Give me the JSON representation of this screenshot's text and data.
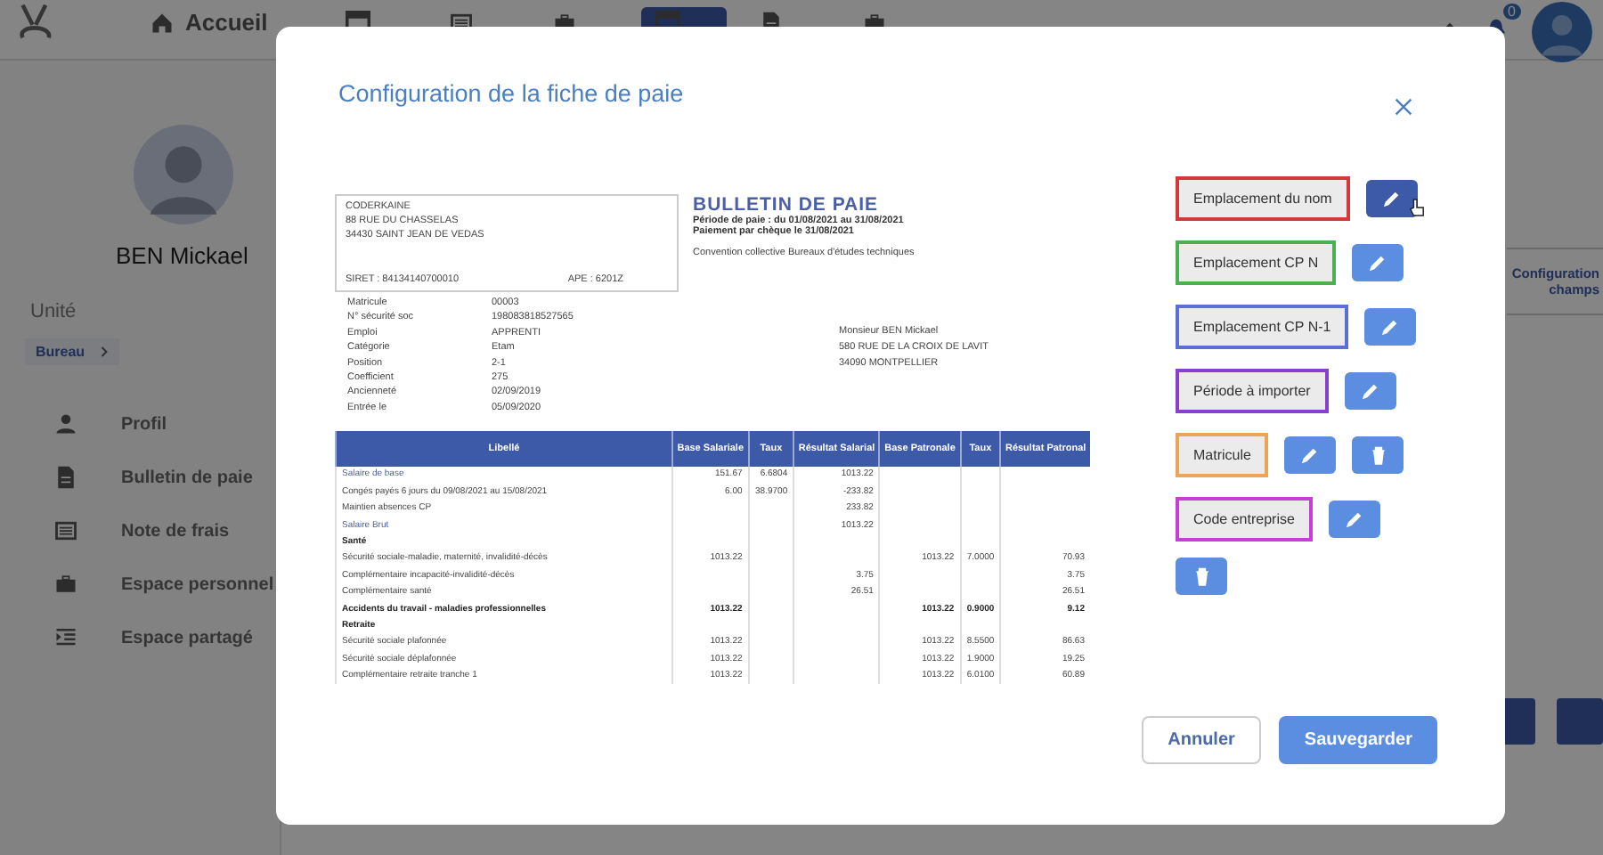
{
  "top_nav": {
    "items": [
      {
        "label": "Accueil",
        "selected": false
      },
      {
        "selected": false
      },
      {
        "selected": false
      },
      {
        "selected": false
      },
      {
        "selected": true
      },
      {
        "selected": false
      },
      {
        "selected": false
      }
    ],
    "badge": "0"
  },
  "sidebar": {
    "profile_name": "BEN Mickael",
    "unit_label": "Unité",
    "unit": "Bureau",
    "items": [
      {
        "label": "Profil"
      },
      {
        "label": "Bulletin de paie"
      },
      {
        "label": "Note de frais"
      },
      {
        "label": "Espace personnel"
      },
      {
        "label": "Espace partagé"
      }
    ]
  },
  "side_panel": {
    "lines": [
      "Configuration",
      "champs"
    ]
  },
  "modal": {
    "title": "Configuration de la fiche de paie",
    "payslip": {
      "employer": {
        "name": "CODERKAINE",
        "street": "88 RUE DU CHASSELAS",
        "city": "34430 SAINT JEAN DE VEDAS",
        "siret": "SIRET : 84134140700010",
        "ape": "APE : 6201Z"
      },
      "title": "BULLETIN DE PAIE",
      "period": "Période de paie : du 01/08/2021 au 31/08/2021",
      "payment": "Paiement par chèque le 31/08/2021",
      "convention": "Convention collective Bureaux d'études techniques",
      "fields": [
        {
          "label": "Matricule",
          "value": "00003"
        },
        {
          "label": "N° sécurité soc",
          "value": "198083818527565"
        },
        {
          "label": "Emploi",
          "value": "APPRENTI"
        },
        {
          "label": "Catégorie",
          "value": "Etam"
        },
        {
          "label": "Position",
          "value": "2-1"
        },
        {
          "label": "Coefficient",
          "value": "275"
        },
        {
          "label": "Ancienneté",
          "value": "02/09/2019"
        },
        {
          "label": "Entrée le",
          "value": "05/09/2020"
        }
      ],
      "recipient": [
        "Monsieur BEN Mickael",
        "580 RUE DE LA CROIX DE LAVIT",
        "34090 MONTPELLIER"
      ],
      "columns": [
        "Libellé",
        "Base Salariale",
        "Taux",
        "Résultat Salarial",
        "Base Patronale",
        "Taux",
        "Résultat Patronal"
      ],
      "rows": [
        {
          "kind": "link",
          "cells": [
            "Salaire de base",
            "151.67",
            "6.6804",
            "1013.22",
            null,
            null,
            null
          ]
        },
        {
          "kind": "normal",
          "cells": [
            "Congés payés 6 jours du 09/08/2021 au 15/08/2021",
            "6.00",
            "38.9700",
            "-233.82",
            null,
            null,
            null
          ]
        },
        {
          "kind": "normal",
          "cells": [
            "Maintien absences CP",
            null,
            null,
            "233.82",
            null,
            null,
            null
          ]
        },
        {
          "kind": "link",
          "cells": [
            "Salaire Brut",
            null,
            null,
            "1013.22",
            null,
            null,
            null
          ]
        },
        {
          "kind": "section",
          "cells": [
            "Santé",
            null,
            null,
            null,
            null,
            null,
            null
          ]
        },
        {
          "kind": "normal",
          "cells": [
            "Sécurité sociale-maladie, maternité, invalidité-décès",
            "1013.22",
            null,
            null,
            "1013.22",
            "7.0000",
            "70.93"
          ]
        },
        {
          "kind": "normal",
          "cells": [
            "Complémentaire incapacité-invalidité-décès",
            null,
            null,
            "3.75",
            null,
            null,
            "3.75"
          ]
        },
        {
          "kind": "normal",
          "cells": [
            "Complémentaire santé",
            null,
            null,
            "26.51",
            null,
            null,
            "26.51"
          ]
        },
        {
          "kind": "section",
          "cells": [
            "Accidents du travail - maladies professionnelles",
            "1013.22",
            null,
            null,
            "1013.22",
            "0.9000",
            "9.12"
          ]
        },
        {
          "kind": "section",
          "cells": [
            "Retraite",
            null,
            null,
            null,
            null,
            null,
            null
          ]
        },
        {
          "kind": "normal",
          "cells": [
            "Sécurité sociale plafonnée",
            "1013.22",
            null,
            null,
            "1013.22",
            "8.5500",
            "86.63"
          ]
        },
        {
          "kind": "normal",
          "cells": [
            "Sécurité sociale déplafonnée",
            "1013.22",
            null,
            null,
            "1013.22",
            "1.9000",
            "19.25"
          ]
        },
        {
          "kind": "normal",
          "cells": [
            "Complémentaire retraite tranche 1",
            "1013.22",
            null,
            null,
            "1013.22",
            "6.0100",
            "60.89"
          ]
        }
      ]
    },
    "zones": [
      {
        "label": "Emplacement du nom",
        "color": "#d23a3a",
        "hovered": true,
        "deletable": false
      },
      {
        "label": "Emplacement CP N",
        "color": "#4caf50",
        "hovered": false,
        "deletable": false
      },
      {
        "label": "Emplacement CP N-1",
        "color": "#5b6fd6",
        "hovered": false,
        "deletable": false
      },
      {
        "label": "Période à importer",
        "color": "#8a3fd1",
        "hovered": false,
        "deletable": false
      },
      {
        "label": "Matricule",
        "color": "#e9a55a",
        "hovered": false,
        "deletable": true
      },
      {
        "label": "Code entreprise",
        "color": "#c53fd6",
        "hovered": false,
        "deletable": true
      }
    ],
    "buttons": {
      "cancel": "Annuler",
      "save": "Sauvegarder"
    }
  }
}
